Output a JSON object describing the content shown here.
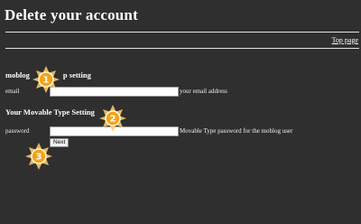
{
  "page": {
    "title": "Delete your account",
    "top_link": "Top page"
  },
  "sections": [
    {
      "heading": "moblog",
      "heading_suffix": "p setting",
      "field_label": "email",
      "input_value": "",
      "hint": "your email address"
    },
    {
      "heading": "Your Movable Type Setting",
      "field_label": "password",
      "input_value": "",
      "hint": "Movable Type password for the moblog user"
    }
  ],
  "buttons": {
    "next": "Next"
  },
  "callouts": [
    "1",
    "2",
    "3"
  ],
  "colors": {
    "background": "#2f2f2f",
    "text": "#ffffff",
    "callout_fill": "#f5a21a",
    "callout_glow": "#ffcf6a"
  }
}
